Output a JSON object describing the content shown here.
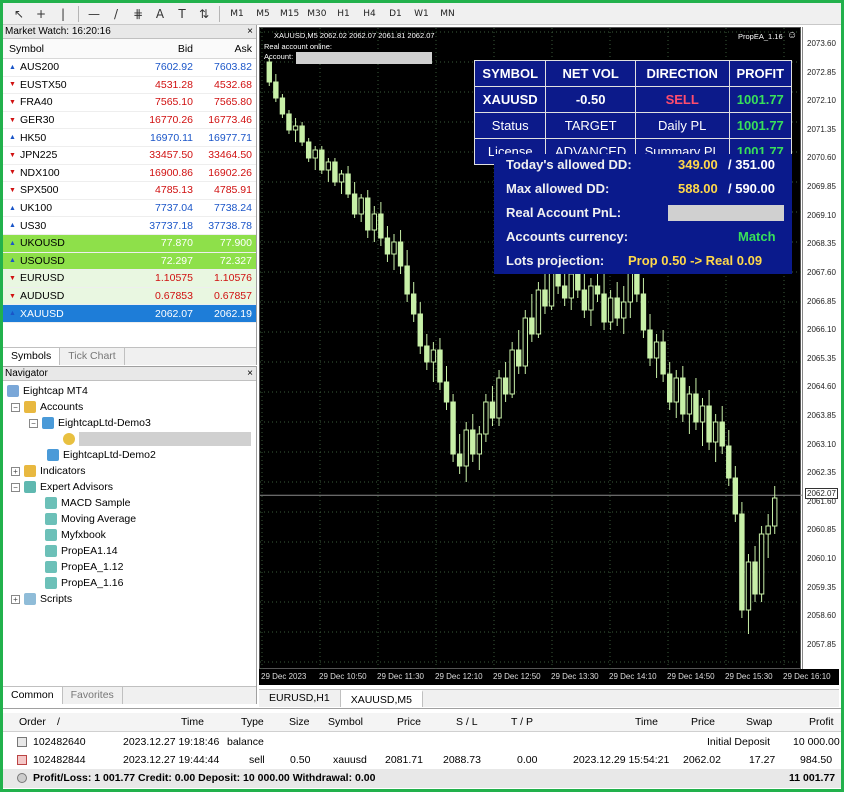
{
  "toolbar": {
    "tools": [
      "cursor-icon",
      "crosshair-icon",
      "vertical-line-icon",
      "horizontal-line-icon",
      "trendline-icon",
      "fibonacci-icon",
      "text-icon",
      "label-icon",
      "arrows-icon"
    ],
    "tool_glyphs": [
      "↖",
      "+",
      "|",
      "—",
      "/",
      "⋕",
      "A",
      "T",
      "⇅"
    ],
    "timeframes": [
      "M1",
      "M5",
      "M15",
      "M30",
      "H1",
      "H4",
      "D1",
      "W1",
      "MN"
    ]
  },
  "market_watch": {
    "title": "Market Watch: 16:20:16",
    "close": "×",
    "headers": {
      "symbol": "Symbol",
      "bid": "Bid",
      "ask": "Ask"
    },
    "rows": [
      {
        "symbol": "AUS200",
        "bid": "7602.92",
        "ask": "7603.82",
        "dir": "up"
      },
      {
        "symbol": "EUSTX50",
        "bid": "4531.28",
        "ask": "4532.68",
        "dir": "dn"
      },
      {
        "symbol": "FRA40",
        "bid": "7565.10",
        "ask": "7565.80",
        "dir": "dn"
      },
      {
        "symbol": "GER30",
        "bid": "16770.26",
        "ask": "16773.46",
        "dir": "dn"
      },
      {
        "symbol": "HK50",
        "bid": "16970.11",
        "ask": "16977.71",
        "dir": "up"
      },
      {
        "symbol": "JPN225",
        "bid": "33457.50",
        "ask": "33464.50",
        "dir": "dn"
      },
      {
        "symbol": "NDX100",
        "bid": "16900.86",
        "ask": "16902.26",
        "dir": "dn"
      },
      {
        "symbol": "SPX500",
        "bid": "4785.13",
        "ask": "4785.91",
        "dir": "dn"
      },
      {
        "symbol": "UK100",
        "bid": "7737.04",
        "ask": "7738.24",
        "dir": "up"
      },
      {
        "symbol": "US30",
        "bid": "37737.18",
        "ask": "37738.78",
        "dir": "up"
      },
      {
        "symbol": "UKOUSD",
        "bid": "77.870",
        "ask": "77.900",
        "dir": "up"
      },
      {
        "symbol": "USOUSD",
        "bid": "72.297",
        "ask": "72.327",
        "dir": "up"
      },
      {
        "symbol": "EURUSD",
        "bid": "1.10575",
        "ask": "1.10576",
        "dir": "dn"
      },
      {
        "symbol": "AUDUSD",
        "bid": "0.67853",
        "ask": "0.67857",
        "dir": "dn"
      },
      {
        "symbol": "XAUUSD",
        "bid": "2062.07",
        "ask": "2062.19",
        "dir": "up"
      }
    ],
    "tabs": [
      "Symbols",
      "Tick Chart"
    ]
  },
  "navigator": {
    "title": "Navigator",
    "close": "×",
    "root": "Eightcap MT4",
    "accounts": "Accounts",
    "account1": "EightcapLtd-Demo3",
    "account2": "EightcapLtd-Demo2",
    "indicators": "Indicators",
    "experts": "Expert Advisors",
    "ea_list": [
      "MACD Sample",
      "Moving Average",
      "Myfxbook",
      "PropEA1.14",
      "PropEA_1.12",
      "PropEA_1.16"
    ],
    "scripts": "Scripts",
    "tabs": [
      "Common",
      "Favorites"
    ]
  },
  "chart": {
    "header": "XAUUSD,M5  2062.02 2062.07 2061.81 2062.07",
    "line2": "Real account online:",
    "line3": "Account:",
    "ea_name": "PropEA_1.16",
    "ea_face": "☺",
    "y_labels": [
      "2073.60",
      "2072.85",
      "2072.10",
      "2071.35",
      "2070.60",
      "2069.85",
      "2069.10",
      "2068.35",
      "2067.60",
      "2066.85",
      "2066.10",
      "2065.35",
      "2064.60",
      "2063.85",
      "2063.10",
      "2062.35",
      "2061.60",
      "2060.85",
      "2060.10",
      "2059.35",
      "2058.60",
      "2057.85"
    ],
    "current_price": "2062.07",
    "x_labels": [
      "29 Dec 2023",
      "29 Dec 10:50",
      "29 Dec 11:30",
      "29 Dec 12:10",
      "29 Dec 12:50",
      "29 Dec 13:30",
      "29 Dec 14:10",
      "29 Dec 14:50",
      "29 Dec 15:30",
      "29 Dec 16:10"
    ],
    "colors": {
      "background": "#000000",
      "candle": "#c8f0a8",
      "grid": "#3a5a3a",
      "price_line": "#8a8a8a"
    }
  },
  "ea_panel": {
    "headers": [
      "SYMBOL",
      "NET VOL",
      "DIRECTION",
      "PROFIT"
    ],
    "row1": [
      "XAUUSD",
      "-0.50",
      "SELL",
      "1001.77"
    ],
    "row2": [
      "Status",
      "TARGET",
      "Daily PL",
      "1001.77"
    ],
    "row3": [
      "License",
      "ADVANCED",
      "Summary PL",
      "1001.77"
    ],
    "info": {
      "today_dd_label": "Today's allowed DD:",
      "today_dd_val": "349.00",
      "today_dd_max": "/ 351.00",
      "max_dd_label": "Max allowed DD:",
      "max_dd_val": "588.00",
      "max_dd_max": "/ 590.00",
      "pnl_label": "Real Account PnL:",
      "currency_label": "Accounts currency:",
      "currency_val": "Match",
      "lots_label": "Lots projection:",
      "lots_val": "Prop 0.50 -> Real 0.09"
    }
  },
  "chart_tabs": [
    "EURUSD,H1",
    "XAUUSD,M5"
  ],
  "terminal": {
    "headers": [
      "Order",
      "/",
      "Time",
      "Type",
      "Size",
      "Symbol",
      "Price",
      "S / L",
      "T / P",
      "Time",
      "Price",
      "Swap",
      "Profit"
    ],
    "row1": {
      "order": "102482640",
      "time": "2023.12.27 19:18:46",
      "type": "balance",
      "comment": "Initial Deposit",
      "profit": "10 000.00"
    },
    "row2": {
      "order": "102482844",
      "time": "2023.12.27 19:44:44",
      "type": "sell",
      "size": "0.50",
      "symbol": "xauusd",
      "price": "2081.71",
      "sl": "2088.73",
      "tp": "0.00",
      "time2": "2023.12.29 15:54:21",
      "price2": "2062.02",
      "swap": "17.27",
      "profit": "984.50"
    },
    "summary": "Profit/Loss: 1 001.77  Credit: 0.00  Deposit: 10 000.00  Withdrawal: 0.00",
    "total": "11 001.77"
  },
  "candles": [
    [
      0,
      2072.9,
      2073.0,
      2072.3,
      2072.4
    ],
    [
      1,
      2072.4,
      2072.6,
      2071.9,
      2072.0
    ],
    [
      2,
      2072.0,
      2072.1,
      2071.5,
      2071.6
    ],
    [
      3,
      2071.6,
      2071.7,
      2071.1,
      2071.2
    ],
    [
      4,
      2071.2,
      2071.5,
      2070.9,
      2071.3
    ],
    [
      5,
      2071.3,
      2071.4,
      2070.8,
      2070.9
    ],
    [
      6,
      2070.9,
      2071.0,
      2070.4,
      2070.5
    ],
    [
      7,
      2070.5,
      2070.8,
      2070.2,
      2070.7
    ],
    [
      8,
      2070.7,
      2070.8,
      2070.1,
      2070.2
    ],
    [
      9,
      2070.2,
      2070.5,
      2069.9,
      2070.4
    ],
    [
      10,
      2070.4,
      2070.5,
      2069.8,
      2069.9
    ],
    [
      11,
      2069.9,
      2070.2,
      2069.6,
      2070.1
    ],
    [
      12,
      2070.1,
      2070.3,
      2069.5,
      2069.6
    ],
    [
      13,
      2069.6,
      2069.9,
      2069.0,
      2069.1
    ],
    [
      14,
      2069.1,
      2069.6,
      2068.9,
      2069.5
    ],
    [
      15,
      2069.5,
      2069.7,
      2068.5,
      2068.7
    ],
    [
      16,
      2068.7,
      2069.3,
      2068.4,
      2069.1
    ],
    [
      17,
      2069.1,
      2069.4,
      2068.3,
      2068.5
    ],
    [
      18,
      2068.5,
      2068.8,
      2067.9,
      2068.1
    ],
    [
      19,
      2068.1,
      2068.6,
      2067.7,
      2068.4
    ],
    [
      20,
      2068.4,
      2068.7,
      2067.6,
      2067.8
    ],
    [
      21,
      2067.8,
      2068.2,
      2066.9,
      2067.1
    ],
    [
      22,
      2067.1,
      2067.4,
      2066.4,
      2066.6
    ],
    [
      23,
      2066.6,
      2066.9,
      2065.6,
      2065.8
    ],
    [
      24,
      2065.8,
      2066.1,
      2065.2,
      2065.4
    ],
    [
      25,
      2065.4,
      2065.9,
      2064.9,
      2065.7
    ],
    [
      26,
      2065.7,
      2066.0,
      2064.7,
      2064.9
    ],
    [
      27,
      2064.9,
      2065.3,
      2064.2,
      2064.4
    ],
    [
      28,
      2064.4,
      2064.6,
      2062.9,
      2063.1
    ],
    [
      29,
      2063.1,
      2063.6,
      2062.6,
      2062.8
    ],
    [
      30,
      2062.8,
      2063.9,
      2062.4,
      2063.7
    ],
    [
      31,
      2063.7,
      2064.1,
      2062.9,
      2063.1
    ],
    [
      32,
      2063.1,
      2063.8,
      2062.7,
      2063.6
    ],
    [
      33,
      2063.6,
      2064.6,
      2063.4,
      2064.4
    ],
    [
      34,
      2064.4,
      2064.8,
      2063.8,
      2064.0
    ],
    [
      35,
      2064.0,
      2065.2,
      2063.8,
      2065.0
    ],
    [
      36,
      2065.0,
      2065.4,
      2064.4,
      2064.6
    ],
    [
      37,
      2064.6,
      2065.9,
      2064.5,
      2065.7
    ],
    [
      38,
      2065.7,
      2066.2,
      2065.1,
      2065.3
    ],
    [
      39,
      2065.3,
      2066.7,
      2065.1,
      2066.5
    ],
    [
      40,
      2066.5,
      2067.1,
      2065.9,
      2066.1
    ],
    [
      41,
      2066.1,
      2067.4,
      2066.0,
      2067.2
    ],
    [
      42,
      2067.2,
      2067.7,
      2066.6,
      2066.8
    ],
    [
      43,
      2066.8,
      2067.9,
      2066.7,
      2067.7
    ],
    [
      44,
      2067.7,
      2068.2,
      2067.1,
      2067.3
    ],
    [
      45,
      2067.3,
      2068.0,
      2066.8,
      2067.0
    ],
    [
      46,
      2067.0,
      2067.8,
      2066.7,
      2067.6
    ],
    [
      47,
      2067.6,
      2068.1,
      2067.0,
      2067.2
    ],
    [
      48,
      2067.2,
      2067.8,
      2066.5,
      2066.7
    ],
    [
      49,
      2066.7,
      2067.5,
      2066.3,
      2067.3
    ],
    [
      50,
      2067.3,
      2067.9,
      2066.9,
      2067.1
    ],
    [
      51,
      2067.1,
      2067.6,
      2066.2,
      2066.4
    ],
    [
      52,
      2066.4,
      2067.2,
      2066.2,
      2067.0
    ],
    [
      53,
      2067.0,
      2067.4,
      2066.3,
      2066.5
    ],
    [
      54,
      2066.5,
      2067.3,
      2066.1,
      2066.9
    ],
    [
      55,
      2066.9,
      2067.9,
      2066.5,
      2067.7
    ],
    [
      56,
      2067.7,
      2068.1,
      2066.9,
      2067.1
    ],
    [
      57,
      2067.1,
      2067.5,
      2066.0,
      2066.2
    ],
    [
      58,
      2066.2,
      2066.6,
      2065.3,
      2065.5
    ],
    [
      59,
      2065.5,
      2066.1,
      2065.0,
      2065.9
    ],
    [
      60,
      2065.9,
      2066.2,
      2064.9,
      2065.1
    ],
    [
      61,
      2065.1,
      2065.4,
      2064.2,
      2064.4
    ],
    [
      62,
      2064.4,
      2065.2,
      2064.0,
      2065.0
    ],
    [
      63,
      2065.0,
      2065.3,
      2063.9,
      2064.1
    ],
    [
      64,
      2064.1,
      2064.8,
      2063.6,
      2064.6
    ],
    [
      65,
      2064.6,
      2065.0,
      2063.7,
      2063.9
    ],
    [
      66,
      2063.9,
      2064.5,
      2063.3,
      2064.3
    ],
    [
      67,
      2064.3,
      2064.7,
      2063.2,
      2063.4
    ],
    [
      68,
      2063.4,
      2064.1,
      2062.9,
      2063.9
    ],
    [
      69,
      2063.9,
      2064.3,
      2063.1,
      2063.3
    ],
    [
      70,
      2063.3,
      2063.7,
      2062.3,
      2062.5
    ],
    [
      71,
      2062.5,
      2062.8,
      2061.4,
      2061.6
    ],
    [
      72,
      2061.6,
      2061.9,
      2059.0,
      2059.2
    ],
    [
      73,
      2059.2,
      2060.6,
      2058.6,
      2060.4
    ],
    [
      74,
      2060.4,
      2060.8,
      2059.4,
      2059.6
    ],
    [
      75,
      2059.6,
      2061.3,
      2059.4,
      2061.1
    ],
    [
      76,
      2061.1,
      2061.6,
      2060.5,
      2061.3
    ],
    [
      77,
      2061.3,
      2062.3,
      2061.1,
      2062.0
    ]
  ]
}
